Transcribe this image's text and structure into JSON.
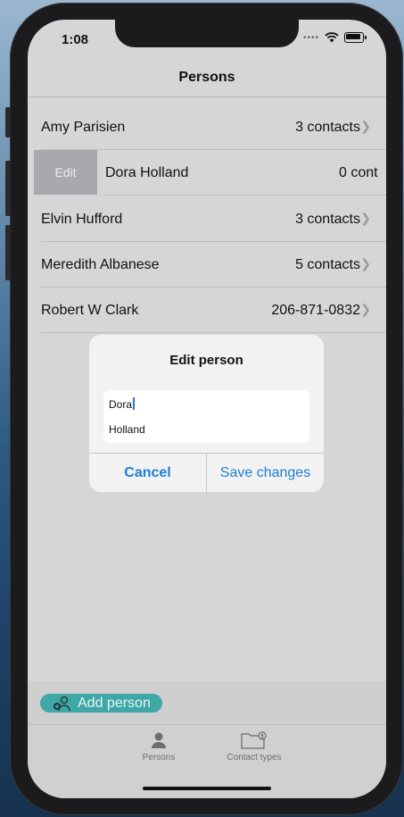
{
  "status_bar": {
    "time": "1:08"
  },
  "nav": {
    "title": "Persons"
  },
  "persons": [
    {
      "name": "Amy Parisien",
      "detail": "3 contacts"
    },
    {
      "name": "Dora Holland",
      "detail": "0 cont",
      "edit_label": "Edit"
    },
    {
      "name": "Elvin Hufford",
      "detail": "3 contacts"
    },
    {
      "name": "Meredith Albanese",
      "detail": "5 contacts"
    },
    {
      "name": "Robert W Clark",
      "detail": "206-871-0832"
    }
  ],
  "dialog": {
    "title": "Edit person",
    "first_name_value": "Dora",
    "last_name_value": "Holland",
    "cancel_label": "Cancel",
    "save_label": "Save changes"
  },
  "add_person": {
    "label": "Add person"
  },
  "tabs": [
    {
      "label": "Persons"
    },
    {
      "label": "Contact types"
    }
  ],
  "colors": {
    "accent_blue": "#1d7fd8",
    "add_button_teal": "#3fa8a6",
    "edit_action_gray": "#a8a8ad"
  },
  "icons": {
    "add_person": "person-plus-icon",
    "persons_tab": "person-icon",
    "contact_types_tab": "folder-person-icon"
  }
}
